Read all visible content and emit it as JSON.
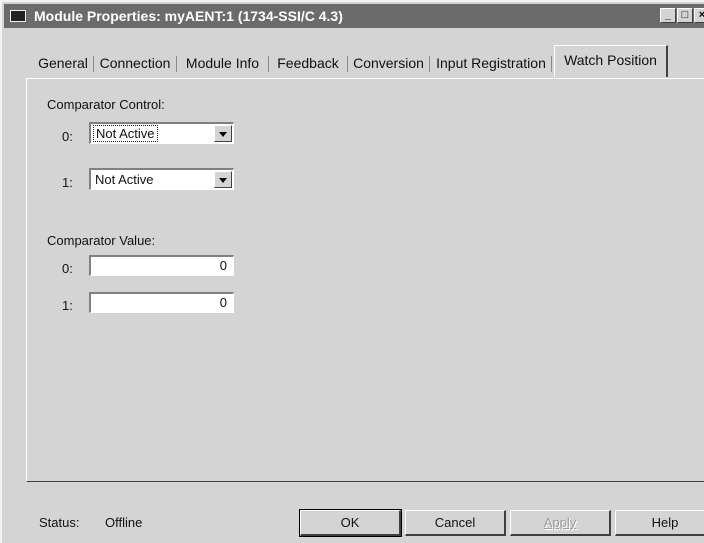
{
  "window": {
    "title": "Module Properties: myAENT:1 (1734-SSI/C 4.3)",
    "minimize_glyph": "_",
    "maximize_glyph": "□",
    "close_glyph": "×"
  },
  "tabs": [
    {
      "label": "General"
    },
    {
      "label": "Connection"
    },
    {
      "label": "Module Info"
    },
    {
      "label": "Feedback"
    },
    {
      "label": "Conversion"
    },
    {
      "label": "Input Registration"
    },
    {
      "label": "Watch Position",
      "active": true
    }
  ],
  "comparator_control": {
    "label": "Comparator Control:",
    "rows": [
      {
        "index_label": "0:",
        "value": "Not Active"
      },
      {
        "index_label": "1:",
        "value": "Not Active"
      }
    ]
  },
  "comparator_value": {
    "label": "Comparator Value:",
    "rows": [
      {
        "index_label": "0:",
        "value": "0"
      },
      {
        "index_label": "1:",
        "value": "0"
      }
    ]
  },
  "status": {
    "label": "Status:",
    "value": "Offline"
  },
  "buttons": {
    "ok": "OK",
    "cancel": "Cancel",
    "apply": "Apply",
    "help": "Help"
  }
}
